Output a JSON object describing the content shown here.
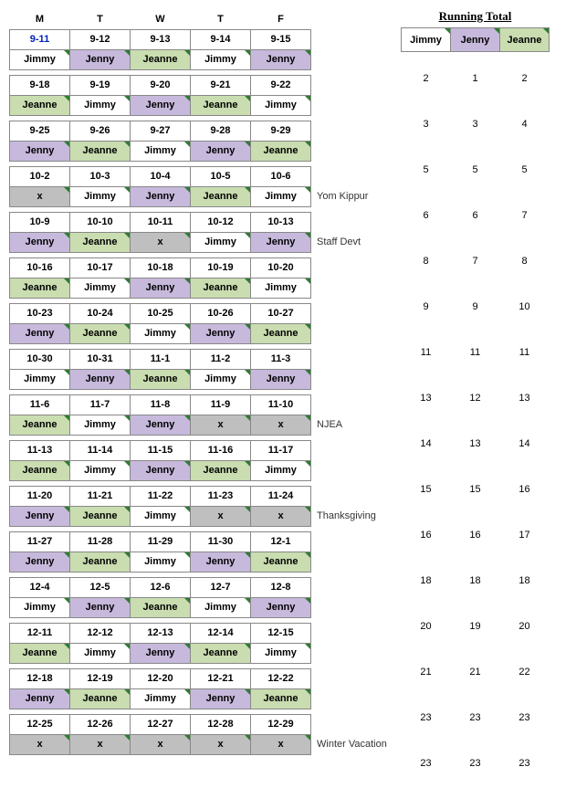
{
  "days": [
    "M",
    "T",
    "W",
    "T",
    "F"
  ],
  "running_title": "Running Total",
  "running_headers": [
    "Jimmy",
    "Jenny",
    "Jeanne"
  ],
  "colors": {
    "Jimmy": "c-jimmy",
    "Jenny": "c-jenny",
    "Jeanne": "c-jeanne",
    "x": "c-x"
  },
  "weeks": [
    {
      "dates": [
        "9-11",
        "9-12",
        "9-13",
        "9-14",
        "9-15"
      ],
      "names": [
        "Jimmy",
        "Jenny",
        "Jeanne",
        "Jimmy",
        "Jenny"
      ],
      "note": "",
      "totals": [
        2,
        1,
        2
      ],
      "first_bold_special": true
    },
    {
      "dates": [
        "9-18",
        "9-19",
        "9-20",
        "9-21",
        "9-22"
      ],
      "names": [
        "Jeanne",
        "Jimmy",
        "Jenny",
        "Jeanne",
        "Jimmy"
      ],
      "note": "",
      "totals": [
        3,
        3,
        4
      ]
    },
    {
      "dates": [
        "9-25",
        "9-26",
        "9-27",
        "9-28",
        "9-29"
      ],
      "names": [
        "Jenny",
        "Jeanne",
        "Jimmy",
        "Jenny",
        "Jeanne"
      ],
      "note": "",
      "totals": [
        5,
        5,
        5
      ]
    },
    {
      "dates": [
        "10-2",
        "10-3",
        "10-4",
        "10-5",
        "10-6"
      ],
      "names": [
        "x",
        "Jimmy",
        "Jenny",
        "Jeanne",
        "Jimmy"
      ],
      "note": "Yom Kippur",
      "totals": [
        6,
        6,
        7
      ]
    },
    {
      "dates": [
        "10-9",
        "10-10",
        "10-11",
        "10-12",
        "10-13"
      ],
      "names": [
        "Jenny",
        "Jeanne",
        "x",
        "Jimmy",
        "Jenny"
      ],
      "note": "Staff Devt",
      "totals": [
        8,
        7,
        8
      ]
    },
    {
      "dates": [
        "10-16",
        "10-17",
        "10-18",
        "10-19",
        "10-20"
      ],
      "names": [
        "Jeanne",
        "Jimmy",
        "Jenny",
        "Jeanne",
        "Jimmy"
      ],
      "note": "",
      "totals": [
        9,
        9,
        10
      ]
    },
    {
      "dates": [
        "10-23",
        "10-24",
        "10-25",
        "10-26",
        "10-27"
      ],
      "names": [
        "Jenny",
        "Jeanne",
        "Jimmy",
        "Jenny",
        "Jeanne"
      ],
      "note": "",
      "totals": [
        11,
        11,
        11
      ]
    },
    {
      "dates": [
        "10-30",
        "10-31",
        "11-1",
        "11-2",
        "11-3"
      ],
      "names": [
        "Jimmy",
        "Jenny",
        "Jeanne",
        "Jimmy",
        "Jenny"
      ],
      "note": "",
      "totals": [
        13,
        12,
        13
      ]
    },
    {
      "dates": [
        "11-6",
        "11-7",
        "11-8",
        "11-9",
        "11-10"
      ],
      "names": [
        "Jeanne",
        "Jimmy",
        "Jenny",
        "x",
        "x"
      ],
      "note": "NJEA",
      "totals": [
        14,
        13,
        14
      ]
    },
    {
      "dates": [
        "11-13",
        "11-14",
        "11-15",
        "11-16",
        "11-17"
      ],
      "names": [
        "Jeanne",
        "Jimmy",
        "Jenny",
        "Jeanne",
        "Jimmy"
      ],
      "note": "",
      "totals": [
        15,
        15,
        16
      ]
    },
    {
      "dates": [
        "11-20",
        "11-21",
        "11-22",
        "11-23",
        "11-24"
      ],
      "names": [
        "Jenny",
        "Jeanne",
        "Jimmy",
        "x",
        "x"
      ],
      "note": "Thanksgiving",
      "totals": [
        16,
        16,
        17
      ]
    },
    {
      "dates": [
        "11-27",
        "11-28",
        "11-29",
        "11-30",
        "12-1"
      ],
      "names": [
        "Jenny",
        "Jeanne",
        "Jimmy",
        "Jenny",
        "Jeanne"
      ],
      "note": "",
      "totals": [
        18,
        18,
        18
      ]
    },
    {
      "dates": [
        "12-4",
        "12-5",
        "12-6",
        "12-7",
        "12-8"
      ],
      "names": [
        "Jimmy",
        "Jenny",
        "Jeanne",
        "Jimmy",
        "Jenny"
      ],
      "note": "",
      "totals": [
        20,
        19,
        20
      ]
    },
    {
      "dates": [
        "12-11",
        "12-12",
        "12-13",
        "12-14",
        "12-15"
      ],
      "names": [
        "Jeanne",
        "Jimmy",
        "Jenny",
        "Jeanne",
        "Jimmy"
      ],
      "note": "",
      "totals": [
        21,
        21,
        22
      ]
    },
    {
      "dates": [
        "12-18",
        "12-19",
        "12-20",
        "12-21",
        "12-22"
      ],
      "names": [
        "Jenny",
        "Jeanne",
        "Jimmy",
        "Jenny",
        "Jeanne"
      ],
      "note": "",
      "totals": [
        23,
        23,
        23
      ]
    },
    {
      "dates": [
        "12-25",
        "12-26",
        "12-27",
        "12-28",
        "12-29"
      ],
      "names": [
        "x",
        "x",
        "x",
        "x",
        "x"
      ],
      "note": "Winter Vacation",
      "totals": [
        23,
        23,
        23
      ]
    }
  ]
}
